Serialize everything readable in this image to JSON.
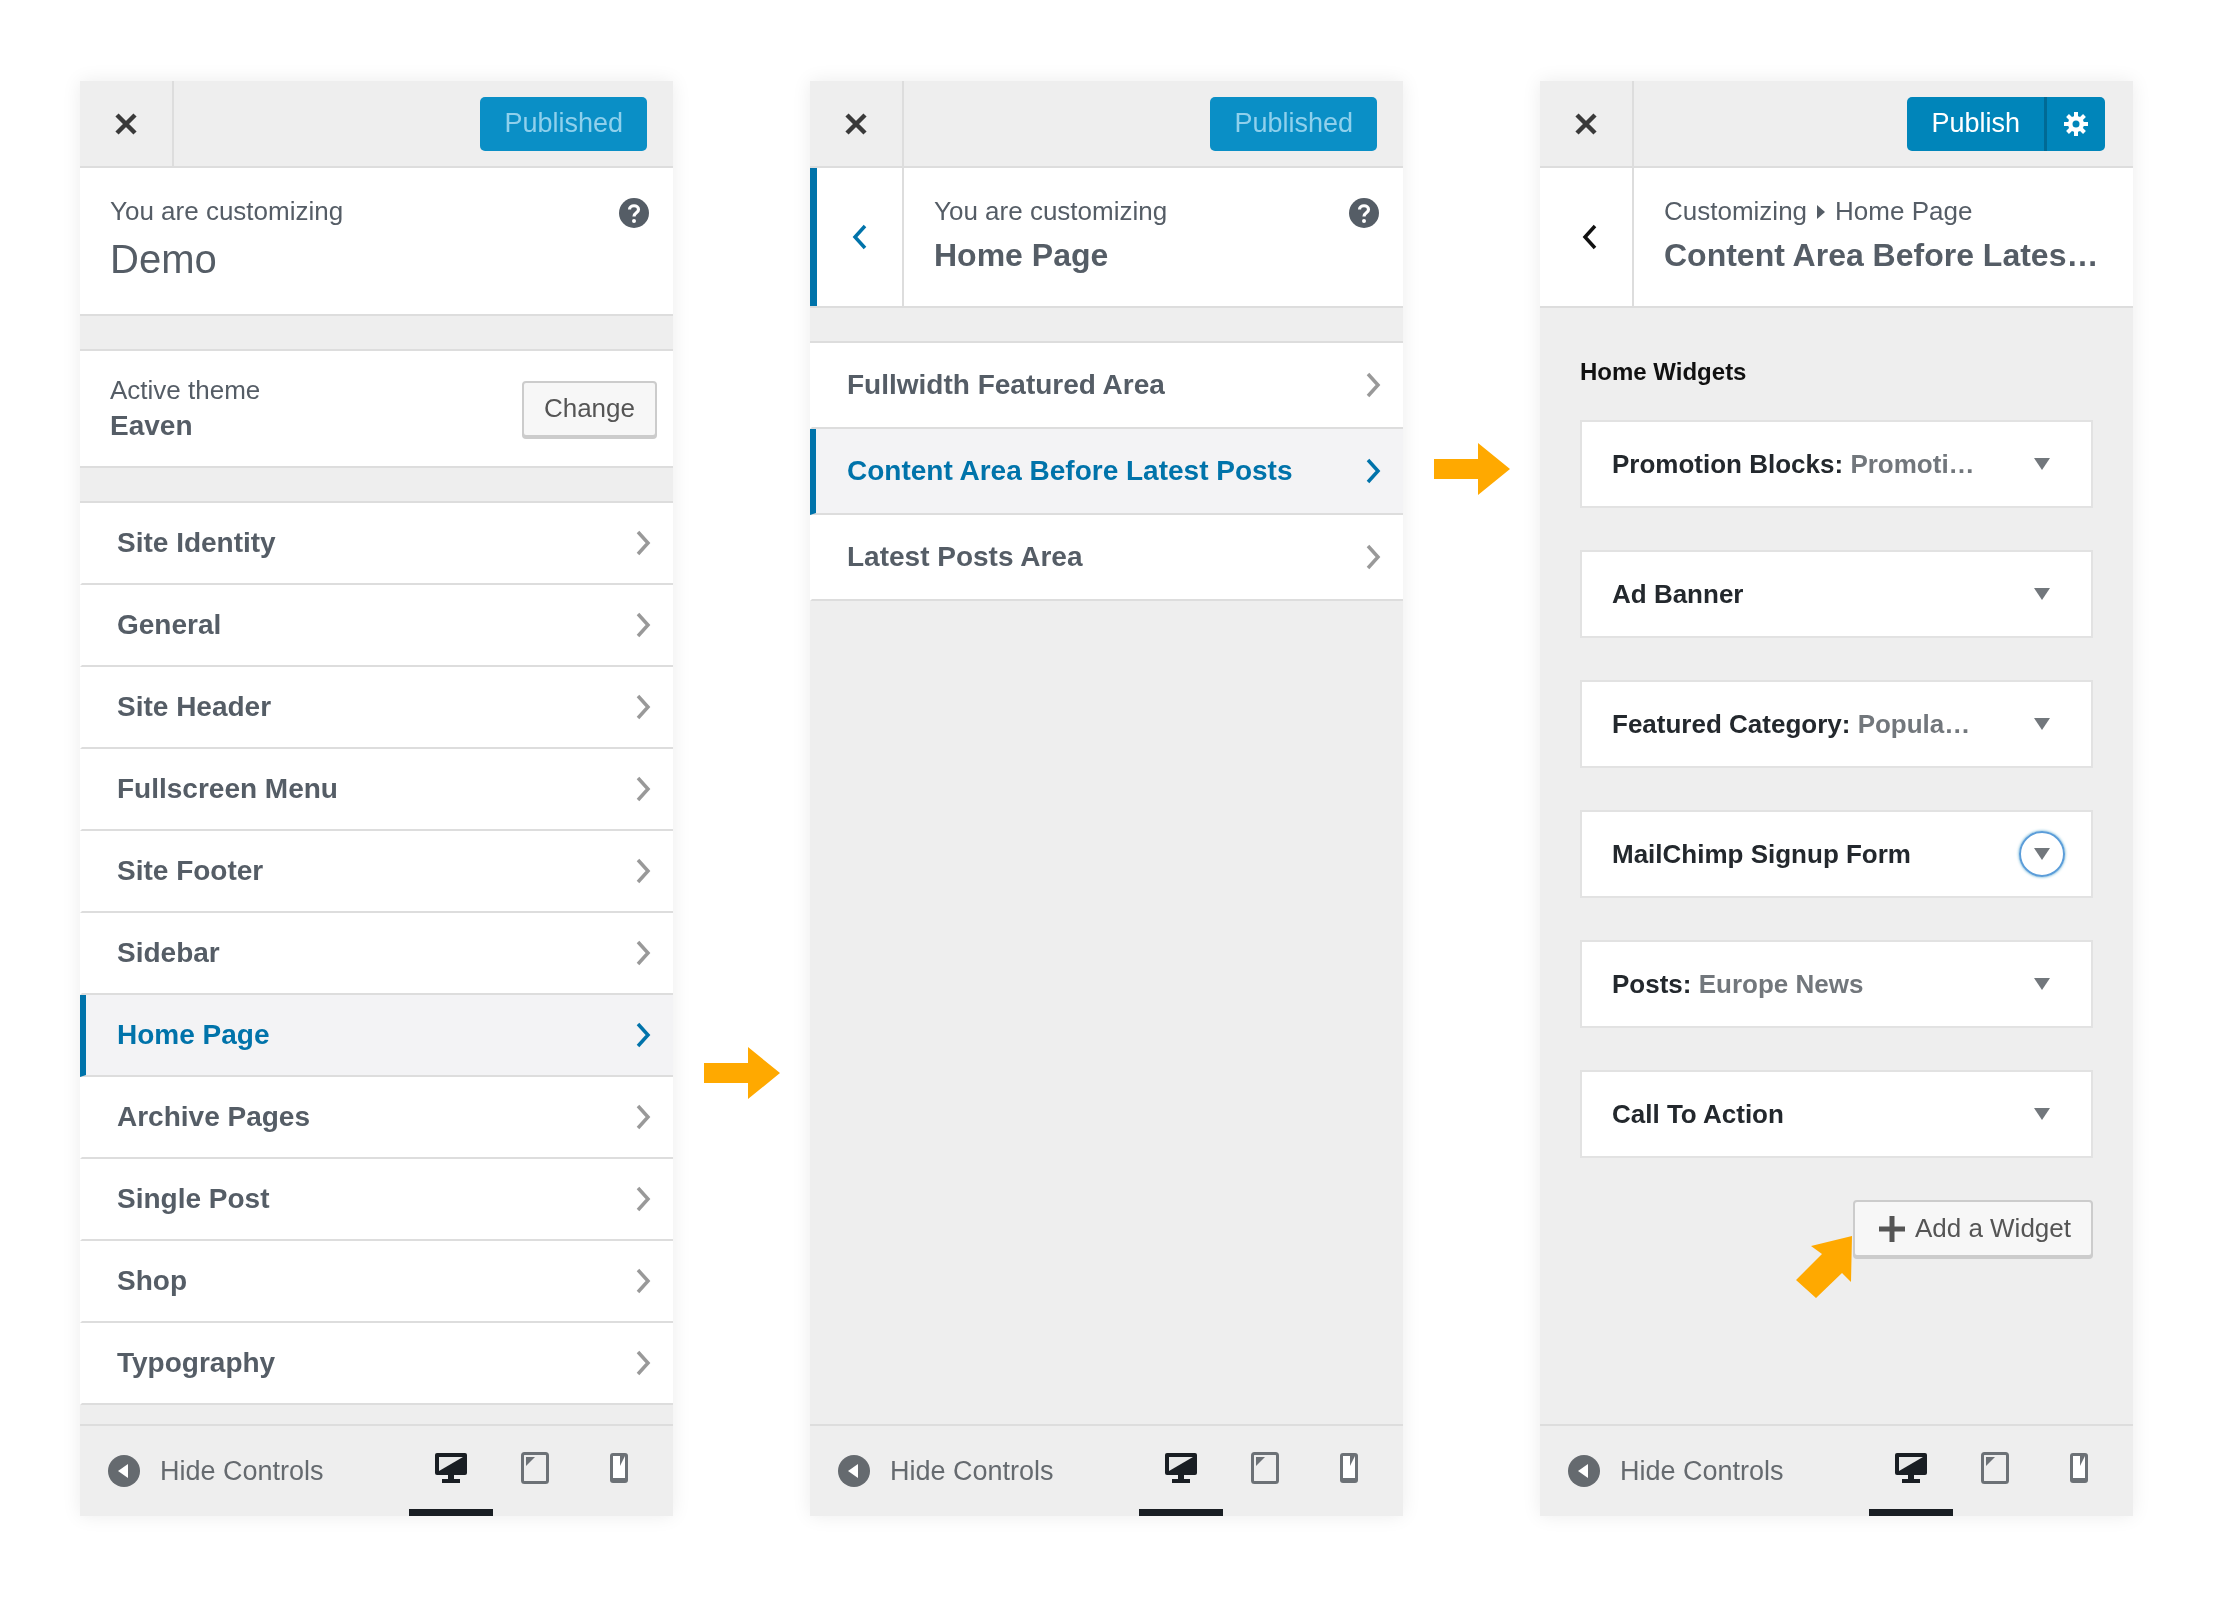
{
  "panels": [
    {
      "kind": "root",
      "publish": {
        "label": "Published",
        "disabled": true
      },
      "info": {
        "caption": "You are customizing",
        "title": "Demo"
      },
      "theme": {
        "caption": "Active theme",
        "name": "Eaven",
        "button": "Change"
      },
      "sections": [
        {
          "label": "Site Identity",
          "selected": false
        },
        {
          "label": "General",
          "selected": false
        },
        {
          "label": "Site Header",
          "selected": false
        },
        {
          "label": "Fullscreen Menu",
          "selected": false
        },
        {
          "label": "Site Footer",
          "selected": false
        },
        {
          "label": "Sidebar",
          "selected": false
        },
        {
          "label": "Home Page",
          "selected": true
        },
        {
          "label": "Archive Pages",
          "selected": false
        },
        {
          "label": "Single Post",
          "selected": false
        },
        {
          "label": "Shop",
          "selected": false
        },
        {
          "label": "Typography",
          "selected": false
        }
      ],
      "footer": {
        "label": "Hide Controls",
        "devices": [
          {
            "kind": "desktop",
            "selected": true
          },
          {
            "kind": "tablet",
            "selected": false
          },
          {
            "kind": "mobile",
            "selected": false
          }
        ]
      }
    },
    {
      "kind": "panel",
      "publish": {
        "label": "Published",
        "disabled": true
      },
      "back": {
        "focused": true
      },
      "info": {
        "caption": "You are customizing",
        "title": "Home Page"
      },
      "sections": [
        {
          "label": "Fullwidth Featured Area",
          "selected": false
        },
        {
          "label": "Content Area Before Latest Posts",
          "selected": true
        },
        {
          "label": "Latest Posts Area",
          "selected": false
        }
      ],
      "footer": {
        "label": "Hide Controls",
        "devices": [
          {
            "kind": "desktop",
            "selected": true
          },
          {
            "kind": "tablet",
            "selected": false
          },
          {
            "kind": "mobile",
            "selected": false
          }
        ]
      }
    },
    {
      "kind": "section",
      "publish": {
        "label": "Publish",
        "disabled": false
      },
      "back": {
        "focused": false
      },
      "info": {
        "breadcrumb": [
          "Customizing",
          "Home Page"
        ],
        "title": "Content Area Before Lates…"
      },
      "area_title": "Home Widgets",
      "widgets": [
        {
          "name": "Promotion Blocks:",
          "detail": "Promoti…",
          "focused": false
        },
        {
          "name": "Ad Banner",
          "focused": false
        },
        {
          "name": "Featured Category:",
          "detail": "Popula…",
          "focused": false
        },
        {
          "name": "MailChimp Signup Form",
          "focused": true
        },
        {
          "name": "Posts:",
          "detail": "Europe News",
          "focused": false
        },
        {
          "name": "Call To Action",
          "focused": false
        }
      ],
      "add_button": "Add a Widget",
      "footer": {
        "label": "Hide Controls",
        "devices": [
          {
            "kind": "desktop",
            "selected": true
          },
          {
            "kind": "tablet",
            "selected": false
          },
          {
            "kind": "mobile",
            "selected": false
          }
        ]
      }
    }
  ]
}
